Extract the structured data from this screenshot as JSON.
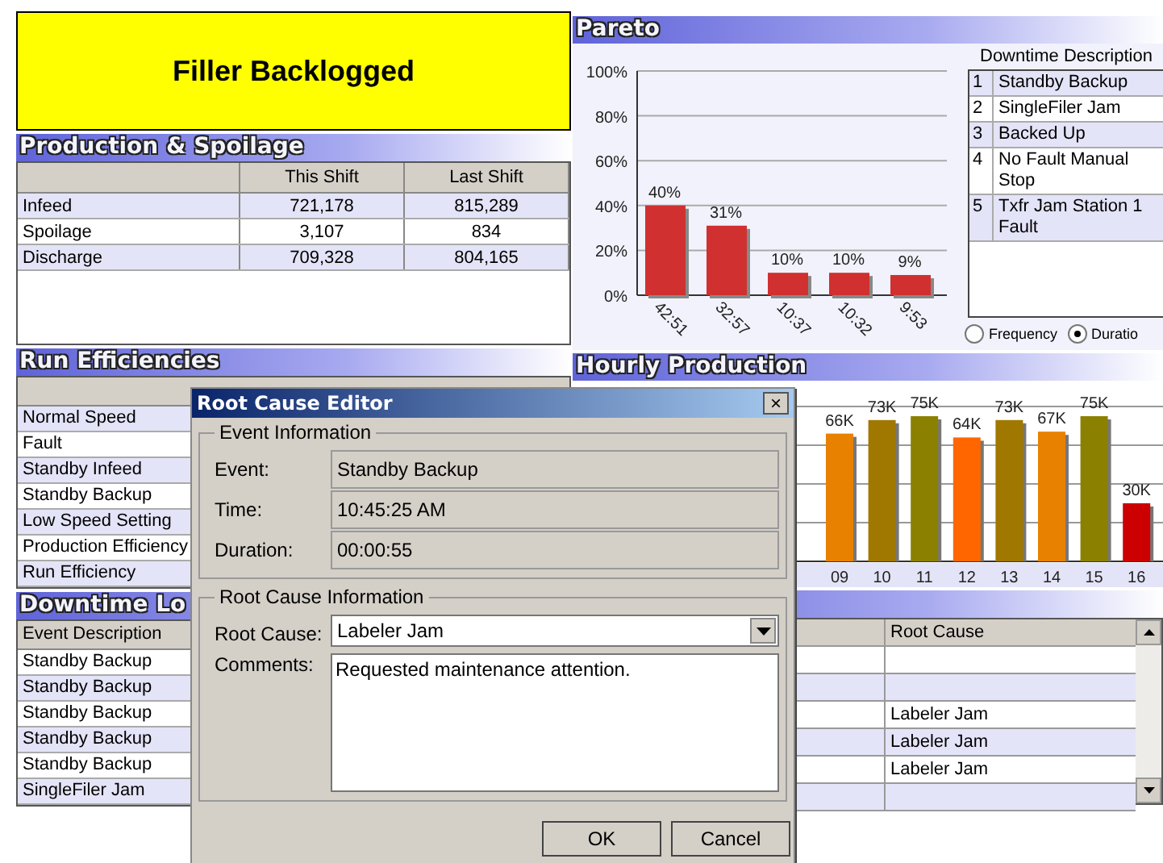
{
  "alarm_banner": {
    "text": "Filler Backlogged"
  },
  "production_spoilage": {
    "title": "Production & Spoilage",
    "columns": [
      "This Shift",
      "Last Shift"
    ],
    "rows": [
      {
        "label": "Infeed",
        "this_shift": "721,178",
        "last_shift": "815,289"
      },
      {
        "label": "Spoilage",
        "this_shift": "3,107",
        "last_shift": "834"
      },
      {
        "label": "Discharge",
        "this_shift": "709,328",
        "last_shift": "804,165"
      }
    ]
  },
  "run_efficiencies": {
    "title": "Run Efficiencies",
    "rows": [
      "Normal Speed",
      "Fault",
      "Standby Infeed",
      "Standby Backup",
      "Low Speed Setting",
      "Production Efficiency",
      "Run Efficiency"
    ]
  },
  "downtime_log": {
    "title": "Downtime Lo",
    "columns": [
      "Event Description",
      "Root Cause"
    ],
    "rows": [
      {
        "event": "Standby Backup"
      },
      {
        "event": "Standby Backup"
      },
      {
        "event": "Standby Backup",
        "root_cause": "Labeler Jam"
      },
      {
        "event": "Standby Backup",
        "root_cause": "Labeler Jam"
      },
      {
        "event": "Standby Backup",
        "root_cause": "Labeler Jam"
      },
      {
        "event": "SingleFiler Jam"
      }
    ]
  },
  "pareto": {
    "title": "Pareto",
    "chart_data": {
      "type": "bar",
      "categories": [
        "42:51",
        "32:57",
        "10:37",
        "10:32",
        "9:53"
      ],
      "values": [
        40,
        31,
        10,
        10,
        9
      ],
      "grid": true,
      "ylim": [
        0,
        100
      ],
      "yticks": [
        {
          "value": 0,
          "label": "0%"
        },
        {
          "value": 20,
          "label": "20%"
        },
        {
          "value": 40,
          "label": "40%"
        },
        {
          "value": 60,
          "label": "60%"
        },
        {
          "value": 80,
          "label": "80%"
        },
        {
          "value": 100,
          "label": "100%"
        }
      ],
      "value_labels": [
        "40%",
        "31%",
        "10%",
        "10%",
        "9%"
      ]
    },
    "description_heading": "Downtime Description",
    "descriptions": [
      {
        "number": "1",
        "text": "Standby Backup"
      },
      {
        "number": "2",
        "text": "SingleFiler Jam"
      },
      {
        "number": "3",
        "text": "Backed Up"
      },
      {
        "number": "4",
        "text": "No Fault Manual Stop"
      },
      {
        "number": "5",
        "text": "Txfr Jam Station 1 Fault"
      }
    ],
    "modes": [
      {
        "label": "Frequency",
        "selected": false
      },
      {
        "label": "Duratio",
        "selected": true
      }
    ]
  },
  "hourly_production": {
    "title": "Hourly Production",
    "chart_data": {
      "type": "bar",
      "categories": [
        "09",
        "10",
        "11",
        "12",
        "13",
        "14",
        "15",
        "16"
      ],
      "values": [
        66,
        73,
        75,
        64,
        73,
        67,
        75,
        30
      ],
      "grid": true,
      "colors": [
        "#e88000",
        "#a07800",
        "#8c8000",
        "#ff6600",
        "#a07800",
        "#e88000",
        "#8c8000",
        "#cc0000"
      ],
      "value_labels": [
        "66K",
        "73K",
        "75K",
        "64K",
        "73K",
        "67K",
        "75K",
        "30K"
      ]
    }
  },
  "dialog": {
    "title": "Root Cause Editor",
    "close": "×",
    "event_group": "Event Information",
    "fields": [
      {
        "label": "Event:",
        "value": "Standby Backup"
      },
      {
        "label": "Time:",
        "value": "10:45:25 AM"
      },
      {
        "label": "Duration:",
        "value": "00:00:55"
      }
    ],
    "cause_group": "Root Cause Information",
    "root_cause_label": "Root Cause:",
    "root_cause": "Labeler Jam",
    "comments_label": "Comments:",
    "comments": "Requested maintenance attention.",
    "buttons": [
      "OK",
      "Cancel"
    ]
  }
}
